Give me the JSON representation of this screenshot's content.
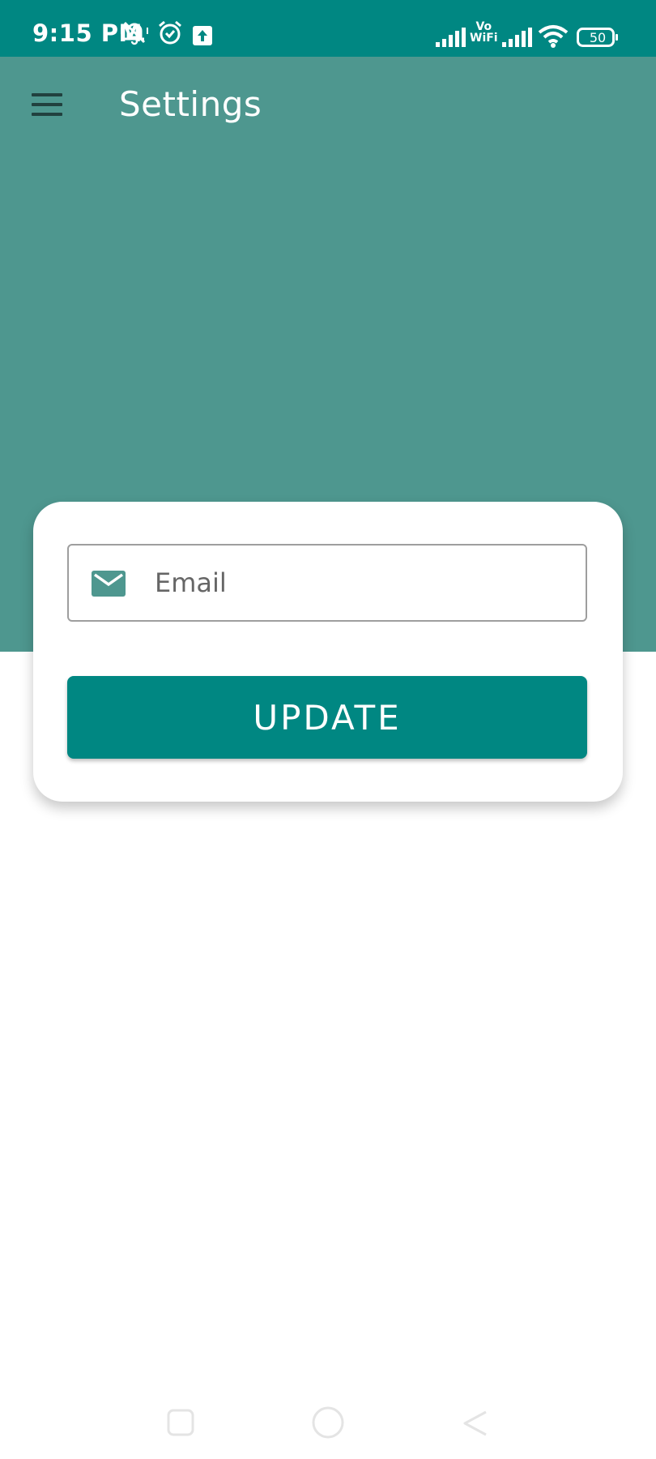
{
  "status_bar": {
    "time": "9:15 PM",
    "vowifi_top": "Vo",
    "vowifi_bottom": "WiFi",
    "battery": "50",
    "icons": [
      "mute-vibrate-icon",
      "alarm-icon",
      "upload-icon",
      "signal-icon",
      "vowifi-icon",
      "signal-icon",
      "wifi-icon",
      "battery-icon"
    ]
  },
  "header": {
    "title": "Settings",
    "menu_icon": "hamburger-menu-icon"
  },
  "form": {
    "email_placeholder": "Email",
    "email_value": "",
    "email_icon": "email-icon",
    "update_label": "UPDATE"
  },
  "nav": {
    "buttons": [
      "recent-apps",
      "home",
      "back"
    ]
  },
  "colors": {
    "status_bar": "#008782",
    "header": "#4e978f",
    "accent": "#008782",
    "menu_icon": "#21413f",
    "email_icon": "#4e978f"
  }
}
